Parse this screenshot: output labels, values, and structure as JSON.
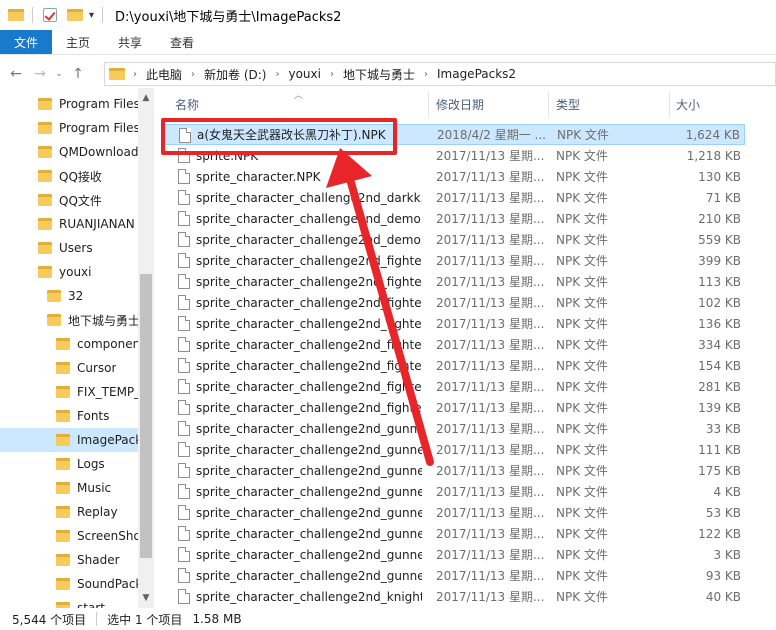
{
  "title_path": "D:\\youxi\\地下城与勇士\\ImagePacks2",
  "ribbon": {
    "tabs": [
      "文件",
      "主页",
      "共享",
      "查看"
    ]
  },
  "breadcrumb": [
    "此电脑",
    "新加卷 (D:)",
    "youxi",
    "地下城与勇士",
    "ImagePacks2"
  ],
  "nav_items": [
    {
      "label": "Program Files",
      "level": 0
    },
    {
      "label": "Program Files",
      "level": 0
    },
    {
      "label": "QMDownload",
      "level": 0
    },
    {
      "label": "QQ接收",
      "level": 0
    },
    {
      "label": "QQ文件",
      "level": 0
    },
    {
      "label": "RUANJIANAN",
      "level": 0
    },
    {
      "label": "Users",
      "level": 0
    },
    {
      "label": "youxi",
      "level": 0
    },
    {
      "label": "32",
      "level": 1
    },
    {
      "label": "地下城与勇士",
      "level": 1
    },
    {
      "label": "componen",
      "level": 2
    },
    {
      "label": "Cursor",
      "level": 2
    },
    {
      "label": "FIX_TEMP_",
      "level": 2
    },
    {
      "label": "Fonts",
      "level": 2
    },
    {
      "label": "ImagePack",
      "level": 2,
      "selected": true
    },
    {
      "label": "Logs",
      "level": 2
    },
    {
      "label": "Music",
      "level": 2
    },
    {
      "label": "Replay",
      "level": 2
    },
    {
      "label": "ScreenShot",
      "level": 2
    },
    {
      "label": "Shader",
      "level": 2
    },
    {
      "label": "SoundPack",
      "level": 2
    },
    {
      "label": "start",
      "level": 2
    }
  ],
  "columns": {
    "name": "名称",
    "date": "修改日期",
    "type": "类型",
    "size": "大小"
  },
  "files": [
    {
      "name": "a(女鬼天全武器改长黑刀补丁).NPK",
      "date": "2018/4/2 星期一 ...",
      "type": "NPK 文件",
      "size": "1,624 KB",
      "selected": true
    },
    {
      "name": "sprite.NPK",
      "date": "2017/11/13 星期...",
      "type": "NPK 文件",
      "size": "1,218 KB"
    },
    {
      "name": "sprite_character.NPK",
      "date": "2017/11/13 星期...",
      "type": "NPK 文件",
      "size": "130 KB"
    },
    {
      "name": "sprite_character_challenge2nd_darkk...",
      "date": "2017/11/13 星期...",
      "type": "NPK 文件",
      "size": "71 KB"
    },
    {
      "name": "sprite_character_challenge2nd_demo...",
      "date": "2017/11/13 星期...",
      "type": "NPK 文件",
      "size": "210 KB"
    },
    {
      "name": "sprite_character_challenge2nd_demo...",
      "date": "2017/11/13 星期...",
      "type": "NPK 文件",
      "size": "559 KB"
    },
    {
      "name": "sprite_character_challenge2nd_fighter...",
      "date": "2017/11/13 星期...",
      "type": "NPK 文件",
      "size": "399 KB"
    },
    {
      "name": "sprite_character_challenge2nd_fighter...",
      "date": "2017/11/13 星期...",
      "type": "NPK 文件",
      "size": "113 KB"
    },
    {
      "name": "sprite_character_challenge2nd_fighter...",
      "date": "2017/11/13 星期...",
      "type": "NPK 文件",
      "size": "102 KB"
    },
    {
      "name": "sprite_character_challenge2nd_fighter...",
      "date": "2017/11/13 星期...",
      "type": "NPK 文件",
      "size": "136 KB"
    },
    {
      "name": "sprite_character_challenge2nd_fighter...",
      "date": "2017/11/13 星期...",
      "type": "NPK 文件",
      "size": "334 KB"
    },
    {
      "name": "sprite_character_challenge2nd_fighter...",
      "date": "2017/11/13 星期...",
      "type": "NPK 文件",
      "size": "154 KB"
    },
    {
      "name": "sprite_character_challenge2nd_fighter...",
      "date": "2017/11/13 星期...",
      "type": "NPK 文件",
      "size": "281 KB"
    },
    {
      "name": "sprite_character_challenge2nd_fighter...",
      "date": "2017/11/13 星期...",
      "type": "NPK 文件",
      "size": "139 KB"
    },
    {
      "name": "sprite_character_challenge2nd_gunne...",
      "date": "2017/11/13 星期...",
      "type": "NPK 文件",
      "size": "33 KB"
    },
    {
      "name": "sprite_character_challenge2nd_gunne...",
      "date": "2017/11/13 星期...",
      "type": "NPK 文件",
      "size": "111 KB"
    },
    {
      "name": "sprite_character_challenge2nd_gunne...",
      "date": "2017/11/13 星期...",
      "type": "NPK 文件",
      "size": "175 KB"
    },
    {
      "name": "sprite_character_challenge2nd_gunne...",
      "date": "2017/11/13 星期...",
      "type": "NPK 文件",
      "size": "4 KB"
    },
    {
      "name": "sprite_character_challenge2nd_gunne...",
      "date": "2017/11/13 星期...",
      "type": "NPK 文件",
      "size": "53 KB"
    },
    {
      "name": "sprite_character_challenge2nd_gunne...",
      "date": "2017/11/13 星期...",
      "type": "NPK 文件",
      "size": "122 KB"
    },
    {
      "name": "sprite_character_challenge2nd_gunne...",
      "date": "2017/11/13 星期...",
      "type": "NPK 文件",
      "size": "3 KB"
    },
    {
      "name": "sprite_character_challenge2nd_gunne...",
      "date": "2017/11/13 星期...",
      "type": "NPK 文件",
      "size": "93 KB"
    },
    {
      "name": "sprite_character_challenge2nd_knight...",
      "date": "2017/11/13 星期...",
      "type": "NPK 文件",
      "size": "40 KB"
    }
  ],
  "status": {
    "item_count": "5,544 个项目",
    "selection": "选中 1 个项目",
    "selection_size": "1.58 MB"
  },
  "colors": {
    "accent": "#1979ca",
    "selection_bg": "#cce8ff",
    "annotation": "#e8262a"
  },
  "icons": [
    "folder-icon",
    "checkbox-icon",
    "back-arrow-icon",
    "forward-arrow-icon",
    "chevron-down-icon",
    "up-arrow-icon",
    "file-icon",
    "sort-up-icon"
  ]
}
